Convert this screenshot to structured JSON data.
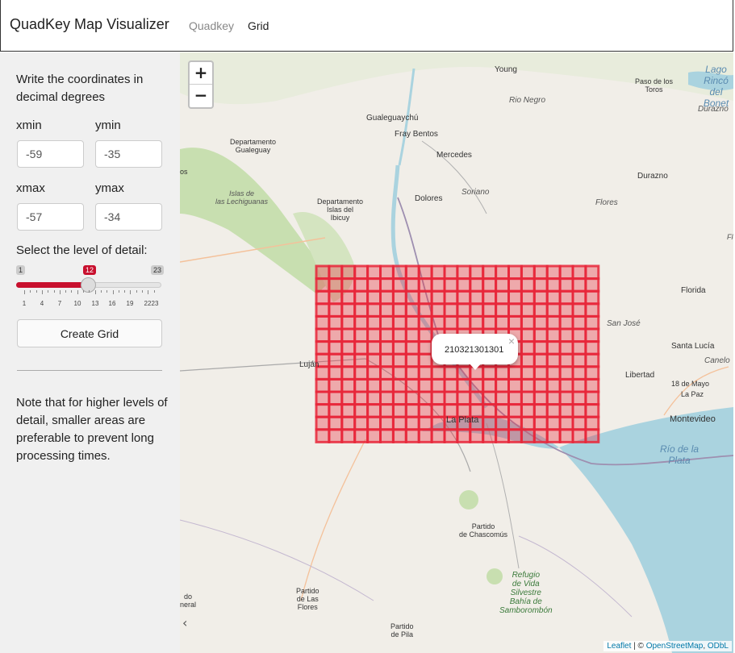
{
  "navbar": {
    "brand": "QuadKey Map Visualizer",
    "tabs": [
      {
        "label": "Quadkey",
        "active": false
      },
      {
        "label": "Grid",
        "active": true
      }
    ]
  },
  "sidebar": {
    "intro": "Write the coordinates in decimal degrees",
    "fields": {
      "xmin": {
        "label": "xmin",
        "value": "-59"
      },
      "ymin": {
        "label": "ymin",
        "value": "-35"
      },
      "xmax": {
        "label": "xmax",
        "value": "-57"
      },
      "ymax": {
        "label": "ymax",
        "value": "-34"
      }
    },
    "slider": {
      "label": "Select the level of detail:",
      "min": "1",
      "max": "23",
      "value": "12",
      "tick_labels": [
        "1",
        "4",
        "7",
        "10",
        "13",
        "16",
        "19",
        "22",
        "23"
      ]
    },
    "button_label": "Create Grid",
    "note": "Note that for higher levels of detail, smaller areas are preferable to prevent long processing times."
  },
  "map": {
    "zoom_in": "+",
    "zoom_out": "−",
    "popup_text": "210321301301",
    "popup_close": "×",
    "collapse_icon": "‹",
    "attribution": {
      "leaflet": "Leaflet",
      "sep": " | © ",
      "osm": "OpenStreetMap",
      "comma": ", ",
      "odbl": "ODbL"
    },
    "grid_color": "#e8273a",
    "water_color": "#aad3df",
    "places": [
      {
        "name": "Young",
        "cls": "md"
      },
      {
        "name": "Rio Negro",
        "cls": "md it"
      },
      {
        "name": "Paso de los\nToros",
        "cls": "sm"
      },
      {
        "name": "Lago Rincó\ndel Bonet",
        "cls": "sm water"
      },
      {
        "name": "Durazno",
        "cls": "md it"
      },
      {
        "name": "Departamento\nGualeguay",
        "cls": "sm"
      },
      {
        "name": "Gualeguaychú",
        "cls": "md"
      },
      {
        "name": "Fray Bentos",
        "cls": "md"
      },
      {
        "name": "Mercedes",
        "cls": "md"
      },
      {
        "name": "Durazno",
        "cls": "md"
      },
      {
        "name": "Islas de\nlas Lechiguanas",
        "cls": "sm it"
      },
      {
        "name": "Departamento\nIslas del\nIbicuy",
        "cls": "sm"
      },
      {
        "name": "Dolores",
        "cls": "md"
      },
      {
        "name": "Soriano",
        "cls": "md it"
      },
      {
        "name": "Flores",
        "cls": "md it"
      },
      {
        "name": "Florida",
        "cls": "md"
      },
      {
        "name": "San José",
        "cls": "md it"
      },
      {
        "name": "Santa Lucía",
        "cls": "md"
      },
      {
        "name": "Canelo",
        "cls": "md it"
      },
      {
        "name": "Libertad",
        "cls": "md"
      },
      {
        "name": "18 de Mayo",
        "cls": "sm"
      },
      {
        "name": "La Paz",
        "cls": "sm"
      },
      {
        "name": "Montevideo",
        "cls": "lg"
      },
      {
        "name": "Río de la\nPlata",
        "cls": "water"
      },
      {
        "name": "Luján",
        "cls": "md"
      },
      {
        "name": "La Plata",
        "cls": "lg"
      },
      {
        "name": "Partido\nde Chascomús",
        "cls": "sm"
      },
      {
        "name": "Refugio\nde Vida\nSilvestre\nBahía de\nSamborombón",
        "cls": "green"
      },
      {
        "name": "Partido\nde Las\nFlores",
        "cls": "sm"
      },
      {
        "name": "Partido\nde Pila",
        "cls": "sm"
      },
      {
        "name": "do\nneral",
        "cls": "sm"
      },
      {
        "name": "os",
        "cls": "sm"
      },
      {
        "name": "Flo",
        "cls": "sm it"
      }
    ]
  }
}
